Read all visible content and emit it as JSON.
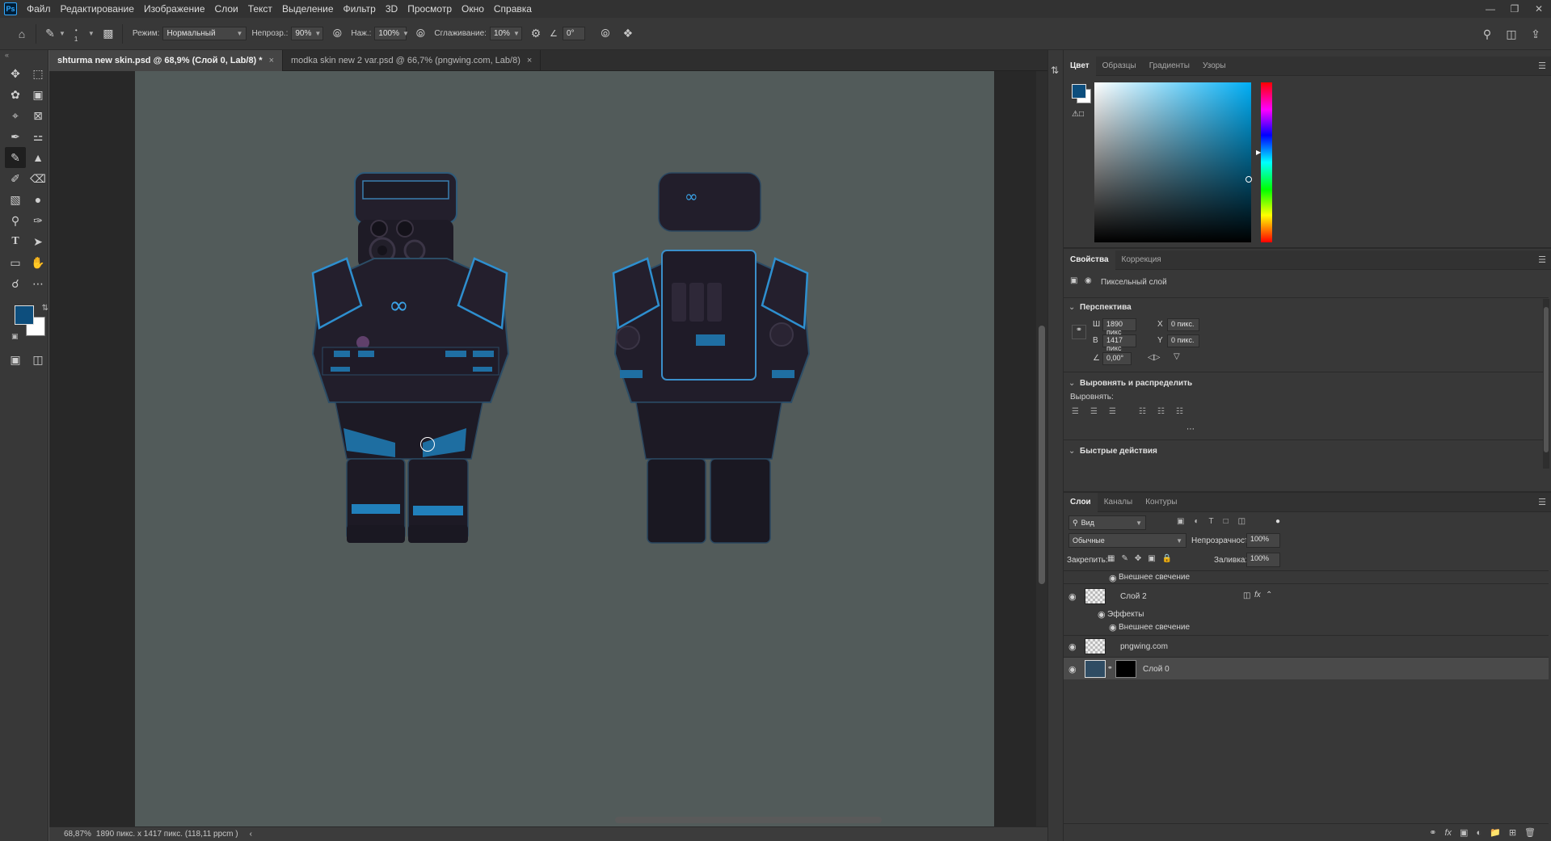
{
  "app": {
    "logo": "Ps"
  },
  "menu": [
    "Файл",
    "Редактирование",
    "Изображение",
    "Слои",
    "Текст",
    "Выделение",
    "Фильтр",
    "3D",
    "Просмотр",
    "Окно",
    "Справка"
  ],
  "options": {
    "brush_size": "1",
    "mode_label": "Режим:",
    "mode_value": "Нормальный",
    "opacity_label": "Непрозр.:",
    "opacity_value": "90%",
    "pressure_label": "Наж.:",
    "pressure_value": "100%",
    "smoothing_label": "Сглаживание:",
    "smoothing_value": "10%",
    "angle_value": "0°"
  },
  "tabs": [
    {
      "label": "shturma new skin.psd @ 68,9% (Слой 0, Lab/8) *",
      "active": true
    },
    {
      "label": "modka skin new 2 var.psd @ 66,7% (pngwing.com, Lab/8)",
      "active": false
    }
  ],
  "status": {
    "zoom": "68,87%",
    "doc_size": "1890 пикс. x 1417 пикс. (118,11 ppcm )"
  },
  "colors": {
    "foreground": "#0d4e7d",
    "background": "#ffffff",
    "canvas": "#525b5a"
  },
  "color_panel": {
    "tabs": [
      "Цвет",
      "Образцы",
      "Градиенты",
      "Узоры"
    ]
  },
  "properties_panel": {
    "tabs": [
      "Свойства",
      "Коррекция"
    ],
    "layer_type": "Пиксельный слой",
    "perspective_title": "Перспектива",
    "w_label": "Ш",
    "w_value": "1890 пикс",
    "h_label": "В",
    "h_value": "1417 пикс",
    "x_label": "X",
    "x_value": "0 пикс.",
    "y_label": "Y",
    "y_value": "0 пикс.",
    "angle_value": "0,00°",
    "align_title": "Выровнять и распределить",
    "align_label": "Выровнять:",
    "quick_title": "Быстрые действия"
  },
  "layers_panel": {
    "tabs": [
      "Слои",
      "Каналы",
      "Контуры"
    ],
    "search_value": "Вид",
    "blend_mode": "Обычные",
    "opacity_label": "Непрозрачность:",
    "opacity_value": "100%",
    "lock_label": "Закрепить:",
    "fill_label": "Заливка:",
    "fill_value": "100%",
    "effect_top": "Внешнее свечение",
    "layers": [
      {
        "name": "Слой 2",
        "effects_label": "Эффекты",
        "effect": "Внешнее свечение"
      },
      {
        "name": "pngwing.com"
      },
      {
        "name": "Слой 0"
      }
    ]
  }
}
